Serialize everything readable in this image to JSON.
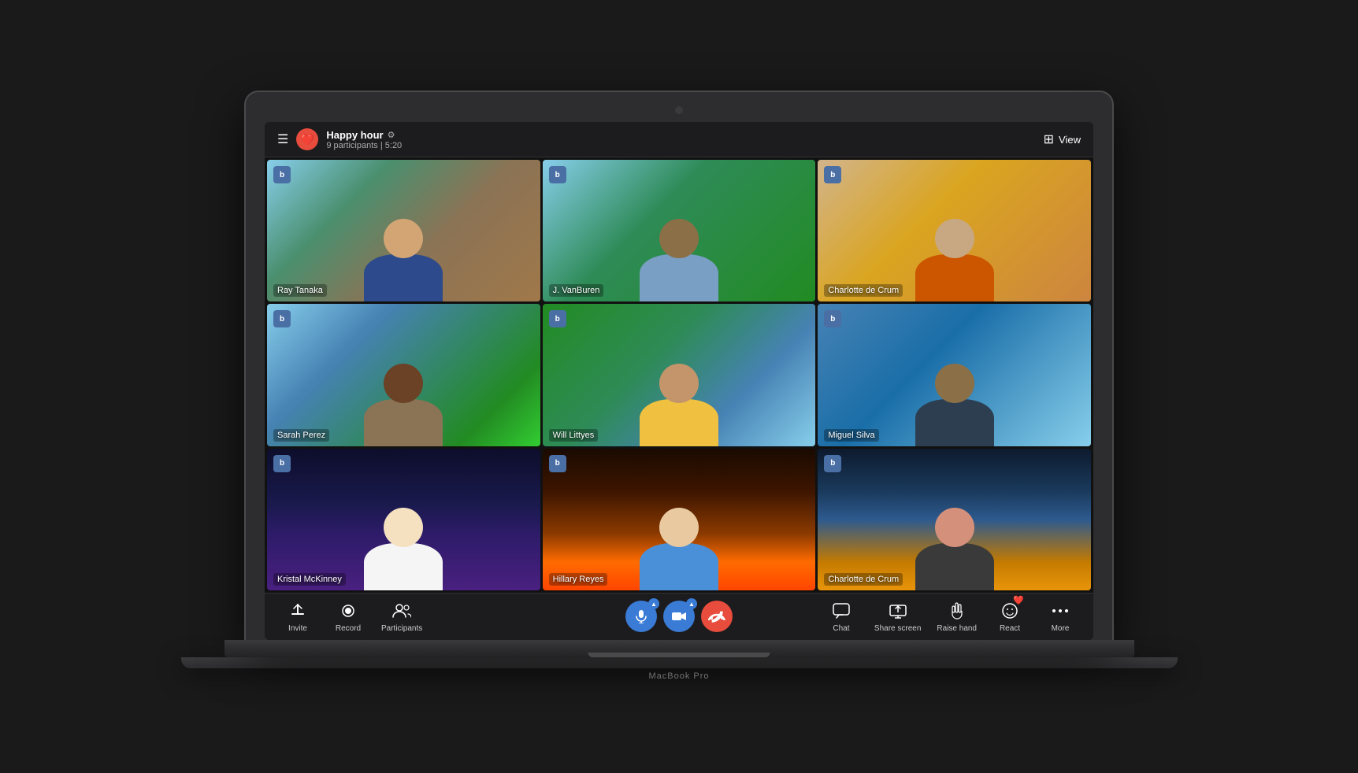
{
  "meeting": {
    "title": "Happy hour",
    "participants_count": "9 participants",
    "duration": "5:20",
    "view_label": "View"
  },
  "participants": [
    {
      "id": 1,
      "name": "Ray Tanaka",
      "tile_class": "tile-1",
      "head_class": "p1-head",
      "body_class": "p1-body"
    },
    {
      "id": 2,
      "name": "J. VanBuren",
      "tile_class": "tile-2",
      "head_class": "p2-head",
      "body_class": "p2-body"
    },
    {
      "id": 3,
      "name": "Charlotte de Crum",
      "tile_class": "tile-3",
      "head_class": "p3-head",
      "body_class": "p3-body"
    },
    {
      "id": 4,
      "name": "Sarah Perez",
      "tile_class": "tile-4",
      "head_class": "p4-head",
      "body_class": "p4-body"
    },
    {
      "id": 5,
      "name": "Will Littyes",
      "tile_class": "tile-5",
      "head_class": "p5-head",
      "body_class": "p5-body"
    },
    {
      "id": 6,
      "name": "Miguel Silva",
      "tile_class": "tile-6",
      "head_class": "p6-head",
      "body_class": "p6-body"
    },
    {
      "id": 7,
      "name": "Kristal McKinney",
      "tile_class": "tile-7",
      "head_class": "p7-head",
      "body_class": "p7-body"
    },
    {
      "id": 8,
      "name": "Hillary Reyes",
      "tile_class": "tile-8",
      "head_class": "p8-head",
      "body_class": "p8-body"
    },
    {
      "id": 9,
      "name": "Charlotte de Crum",
      "tile_class": "tile-9",
      "head_class": "p9-head",
      "body_class": "p9-body"
    }
  ],
  "toolbar": {
    "left": [
      {
        "id": "invite",
        "icon": "⬆",
        "label": "Invite"
      },
      {
        "id": "record",
        "icon": "⏺",
        "label": "Record"
      },
      {
        "id": "participants",
        "icon": "👥",
        "label": "Participants"
      }
    ],
    "center": [
      {
        "id": "mic",
        "icon": "🎤",
        "color": "#3a7bd5",
        "has_expand": true
      },
      {
        "id": "camera",
        "icon": "📷",
        "color": "#3a7bd5",
        "has_expand": false
      },
      {
        "id": "end",
        "icon": "📞",
        "color": "#e74c3c",
        "has_expand": false
      }
    ],
    "right": [
      {
        "id": "chat",
        "icon": "💬",
        "label": "Chat"
      },
      {
        "id": "share-screen",
        "icon": "⬆",
        "label": "Share screen"
      },
      {
        "id": "raise-hand",
        "icon": "✋",
        "label": "Raise hand"
      },
      {
        "id": "react",
        "icon": "❤️",
        "label": "React"
      },
      {
        "id": "more",
        "icon": "•••",
        "label": "More"
      }
    ]
  },
  "laptop": {
    "model": "MacBook Pro"
  }
}
